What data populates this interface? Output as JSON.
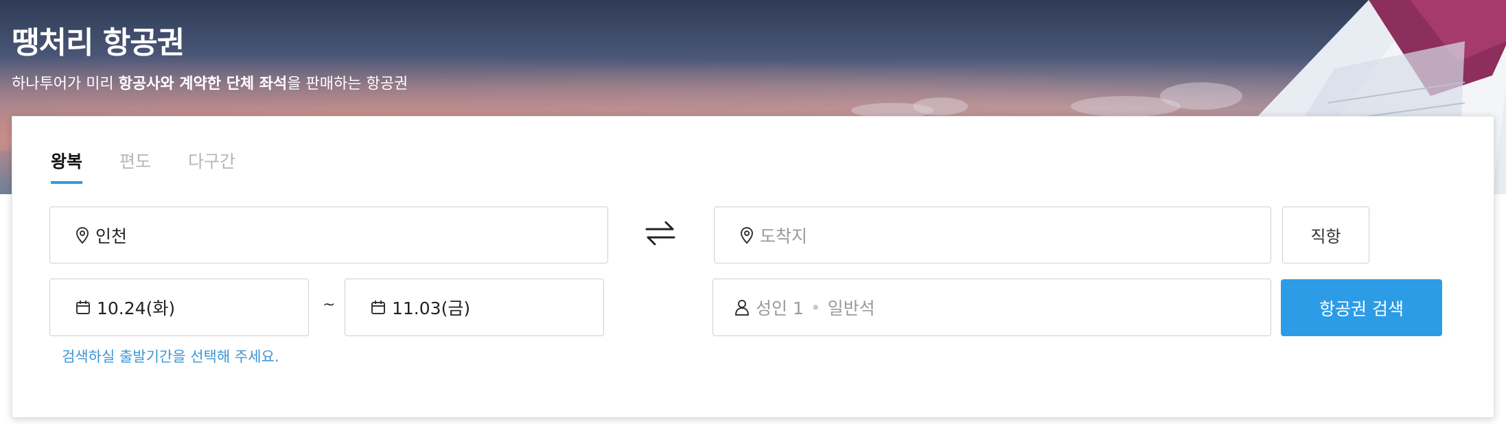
{
  "hero": {
    "title": "땡처리 항공권",
    "subtitle_pre": "하나투어가 미리 ",
    "subtitle_bold": "항공사와 계약한 단체 좌석",
    "subtitle_post": "을 판매하는 항공권"
  },
  "tabs": [
    {
      "label": "왕복",
      "active": true
    },
    {
      "label": "편도",
      "active": false
    },
    {
      "label": "다구간",
      "active": false
    }
  ],
  "departure": {
    "value": "인천",
    "icon": "location-pin-icon"
  },
  "arrival": {
    "placeholder": "도착지",
    "icon": "location-pin-icon"
  },
  "swap_icon": "swap-arrows-icon",
  "direct_label": "직항",
  "dates": {
    "start": "10.24(화)",
    "separator": "~",
    "end": "11.03(금)",
    "icon": "calendar-icon",
    "hint": "검색하실 출발기간을 선택해 주세요."
  },
  "passengers": {
    "count_label": "성인 1",
    "separator": "•",
    "class_label": "일반석",
    "icon": "person-icon"
  },
  "search_button": "항공권 검색",
  "colors": {
    "accent": "#2c9ce6",
    "hint_text": "#3a95d6"
  }
}
